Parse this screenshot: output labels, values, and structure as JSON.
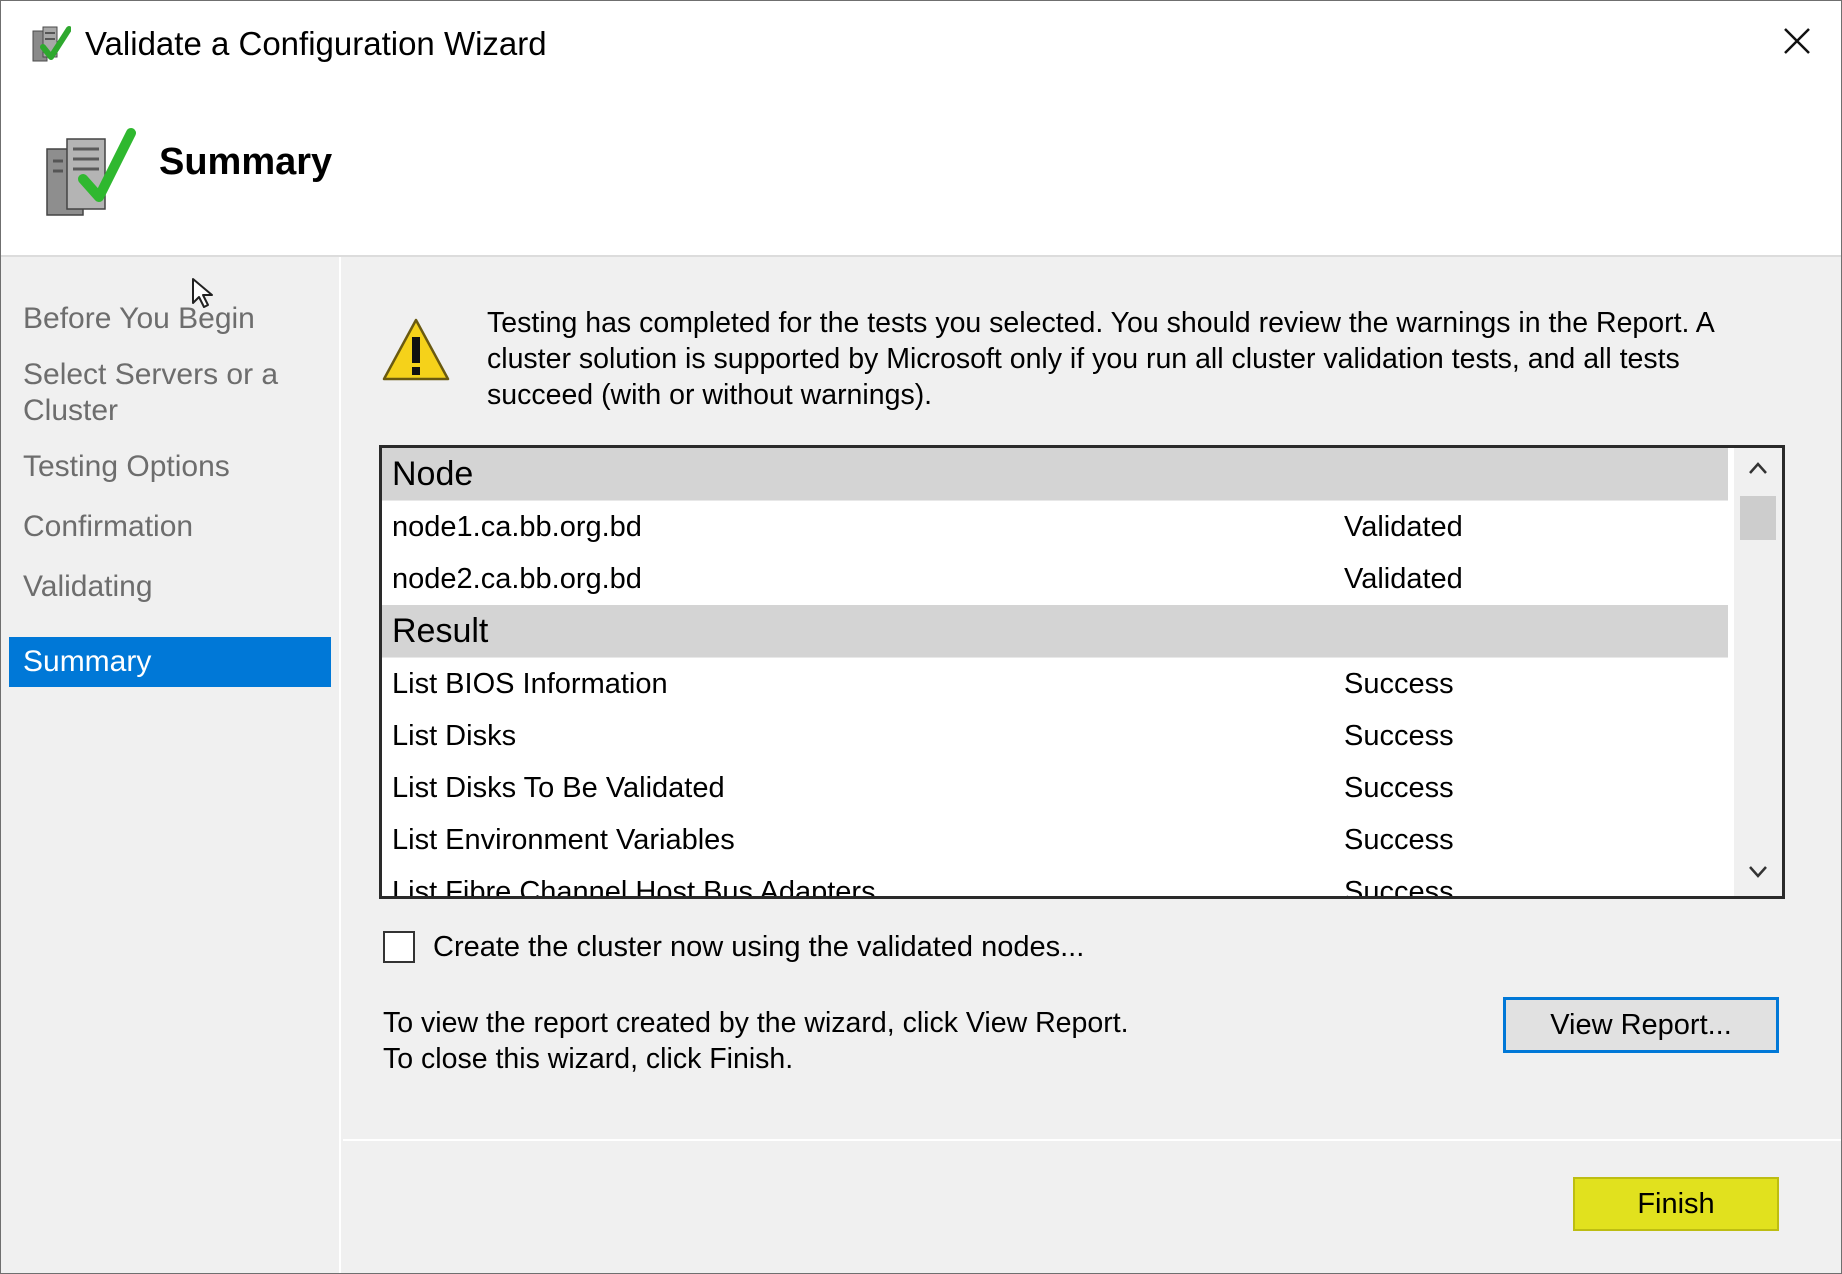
{
  "window": {
    "title": "Validate a Configuration Wizard",
    "icon": "cluster-validate-icon",
    "close_icon": "close-icon"
  },
  "header": {
    "title": "Summary",
    "icon": "server-checkmark-icon"
  },
  "steps": [
    {
      "label": "Before You Begin",
      "active": false
    },
    {
      "label": "Select Servers or a Cluster",
      "active": false
    },
    {
      "label": "Testing Options",
      "active": false
    },
    {
      "label": "Confirmation",
      "active": false
    },
    {
      "label": "Validating",
      "active": false
    },
    {
      "label": "Summary",
      "active": true
    }
  ],
  "message": {
    "icon": "warning-icon",
    "text": "Testing has completed for the tests you selected. You should review the warnings in the Report.  A cluster solution is supported by Microsoft only if you run all cluster validation tests, and all tests succeed (with or without warnings)."
  },
  "results": {
    "node_header": "Node",
    "nodes": [
      {
        "name": "node1.ca.bb.org.bd",
        "status": "Validated"
      },
      {
        "name": "node2.ca.bb.org.bd",
        "status": "Validated"
      }
    ],
    "result_header": "Result",
    "tests": [
      {
        "name": "List BIOS Information",
        "status": "Success"
      },
      {
        "name": "List Disks",
        "status": "Success"
      },
      {
        "name": "List Disks To Be Validated",
        "status": "Success"
      },
      {
        "name": "List Environment Variables",
        "status": "Success"
      },
      {
        "name": "List Fibre Channel Host Bus Adapters",
        "status": "Success"
      }
    ]
  },
  "create_cluster_checkbox": {
    "label": "Create the cluster now using the validated nodes...",
    "checked": false
  },
  "info": {
    "line1": "To view the report created by the wizard, click View Report.",
    "line2": "To close this wizard, click Finish."
  },
  "buttons": {
    "view_report": "View Report...",
    "finish": "Finish"
  },
  "colors": {
    "accent": "#0078d7",
    "finish_highlight": "#e1e11e"
  }
}
